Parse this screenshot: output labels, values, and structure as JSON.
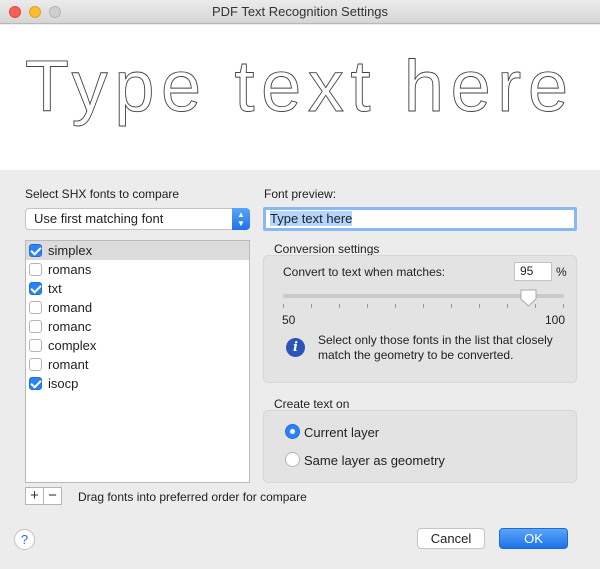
{
  "window": {
    "title": "PDF Text Recognition Settings"
  },
  "preview_text": "Type text here",
  "left": {
    "section_label": "Select SHX fonts to compare",
    "dropdown_value": "Use first matching font",
    "fonts": [
      {
        "name": "simplex",
        "checked": true,
        "selected": true
      },
      {
        "name": "romans",
        "checked": false,
        "selected": false
      },
      {
        "name": "txt",
        "checked": true,
        "selected": false
      },
      {
        "name": "romand",
        "checked": false,
        "selected": false
      },
      {
        "name": "romanc",
        "checked": false,
        "selected": false
      },
      {
        "name": "complex",
        "checked": false,
        "selected": false
      },
      {
        "name": "romant",
        "checked": false,
        "selected": false
      },
      {
        "name": "isocp",
        "checked": true,
        "selected": false
      }
    ],
    "add_label": "+",
    "remove_label": "−",
    "hint": "Drag fonts into preferred order for compare"
  },
  "right": {
    "font_preview_label": "Font preview:",
    "font_preview_value": "Type text here",
    "conversion": {
      "title": "Conversion settings",
      "match_label": "Convert to text when matches:",
      "match_value": "95",
      "unit": "%",
      "slider_min": "50",
      "slider_max": "100",
      "slider_value": 95,
      "info": "Select only those fonts in the list that closely match the geometry to be converted."
    },
    "create_on": {
      "title": "Create text on",
      "options": [
        {
          "label": "Current layer",
          "selected": true
        },
        {
          "label": "Same layer as geometry",
          "selected": false
        }
      ]
    }
  },
  "footer": {
    "help_label": "?",
    "cancel_label": "Cancel",
    "ok_label": "OK"
  },
  "colors": {
    "accent": "#2a82f7",
    "info_icon": "#2c54b8"
  }
}
